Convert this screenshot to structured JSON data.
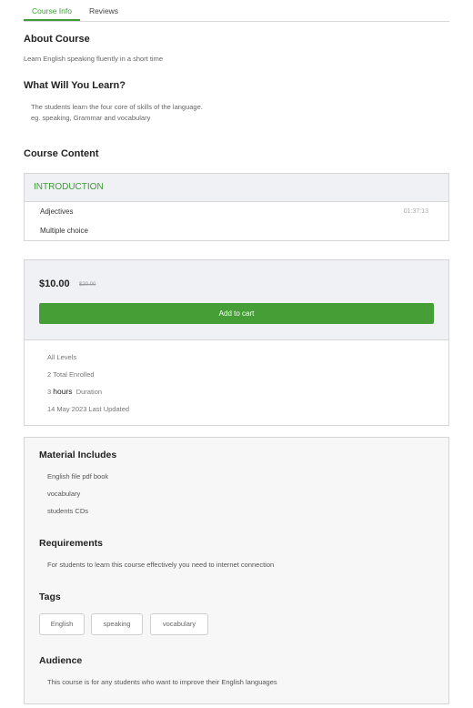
{
  "tabs": [
    "Course Info",
    "Reviews"
  ],
  "about": {
    "heading": "About Course",
    "text": "Learn English speaking fluently in a short time"
  },
  "learn": {
    "heading": "What Will You Learn?",
    "line1": "The students learn the four core of skills of the language.",
    "line2": "eg. speaking, Grammar and vocabulary"
  },
  "content": {
    "heading": "Course Content",
    "section": "INTRODUCTION",
    "lessons": [
      {
        "title": "Adjectives",
        "duration": "01:37:13"
      },
      {
        "title": "Multiple choice",
        "duration": ""
      }
    ]
  },
  "pricing": {
    "price": "$10.00",
    "old_price": "$20.00",
    "cart_label": "Add to cart",
    "level": "All Levels",
    "enrolled": "2 Total Enrolled",
    "duration_num": "3",
    "duration_unit": "hours",
    "duration_label": "Duration",
    "updated": "14 May 2023 Last Updated"
  },
  "materials": {
    "heading": "Material Includes",
    "items": [
      "English file pdf book",
      "vocabulary",
      "students CDs"
    ]
  },
  "requirements": {
    "heading": "Requirements",
    "text": "For students to learn this course effectively you need to internet connection"
  },
  "tags": {
    "heading": "Tags",
    "items": [
      "English",
      "speaking",
      "vocabulary"
    ]
  },
  "audience": {
    "heading": "Audience",
    "text": "This course is for any students who want to improve their English languages"
  },
  "colors": {
    "accent": "#3f9a38",
    "button": "#469e37"
  }
}
